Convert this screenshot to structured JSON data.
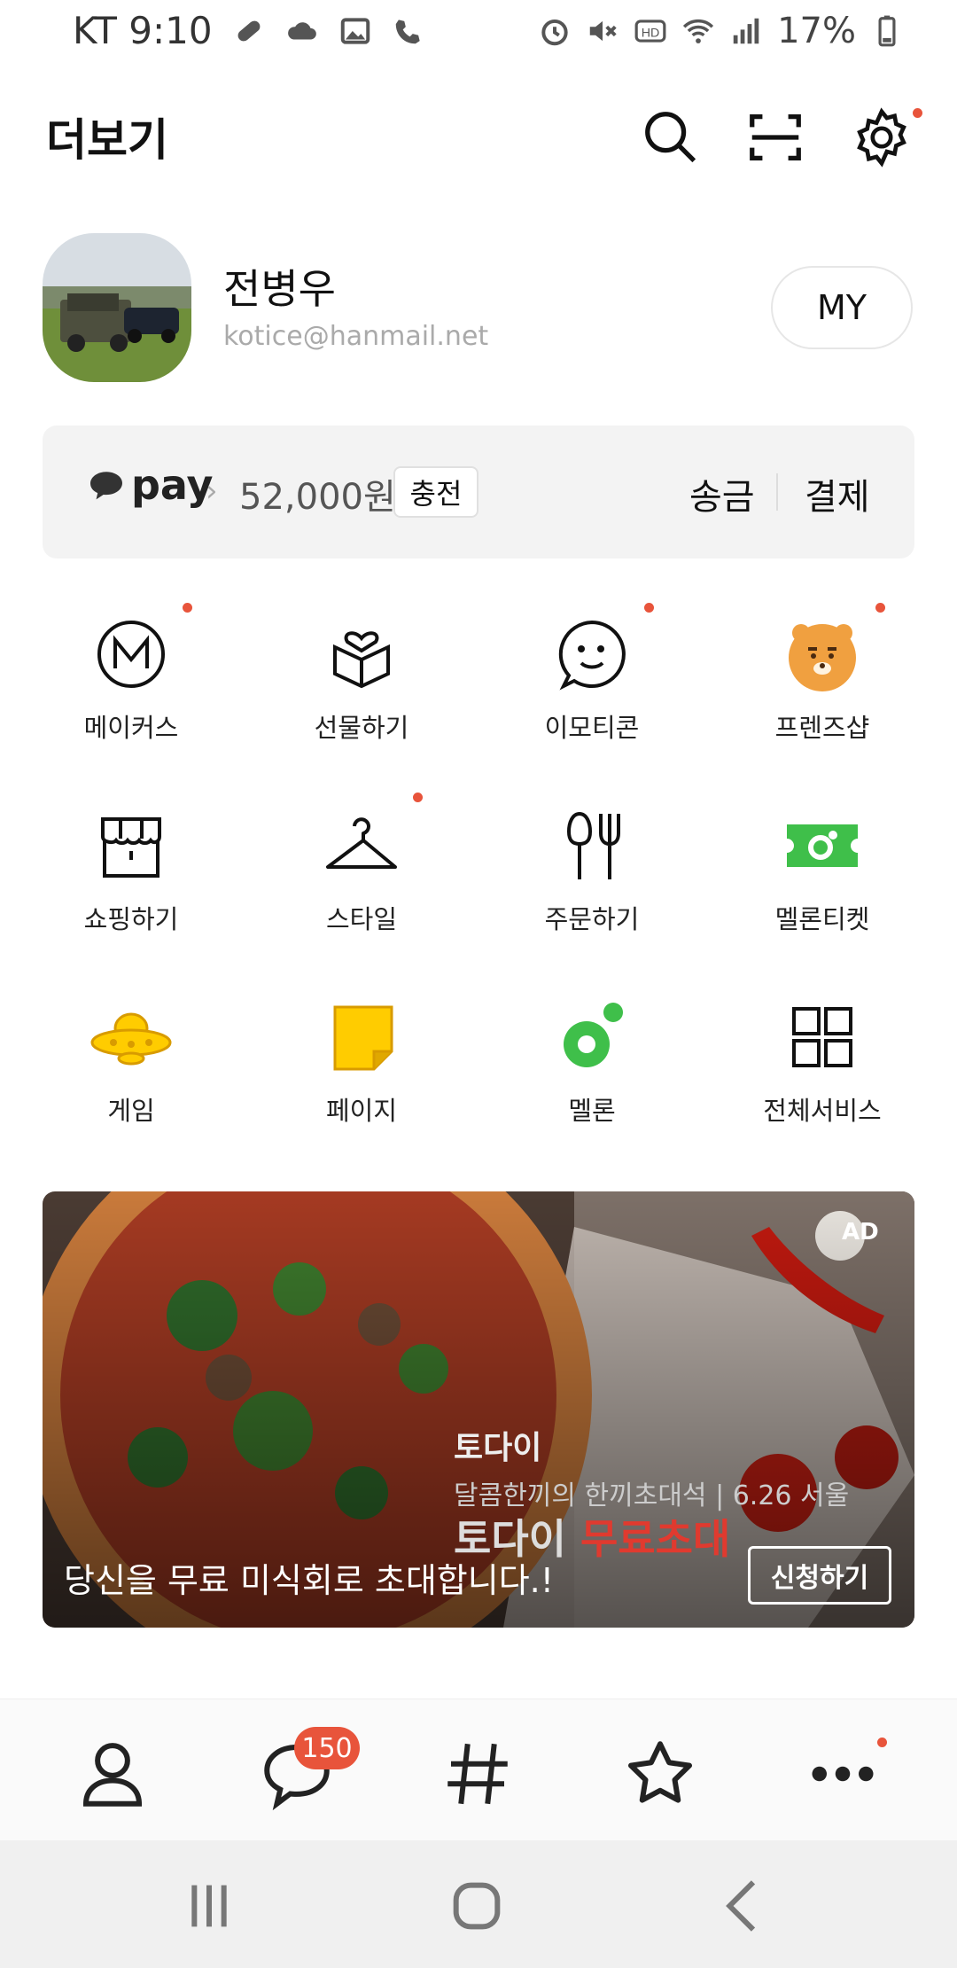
{
  "status_bar": {
    "carrier_time": "KT 9:10",
    "battery": "17%",
    "left_icons": [
      "pill-icon",
      "cloud-icon",
      "image-icon",
      "whowho-call-icon"
    ],
    "right_icons": [
      "alarm-icon",
      "mute-icon",
      "hd-icon",
      "wifi-icon",
      "signal-icon",
      "battery-icon"
    ]
  },
  "header": {
    "title": "더보기",
    "icons": [
      "search-icon",
      "scan-icon",
      "settings-icon"
    ],
    "settings_has_dot": true
  },
  "profile": {
    "name": "전병우",
    "email": "kotice@hanmail.net",
    "my_label": "MY"
  },
  "pay": {
    "logo": "pay",
    "chevron": "›",
    "amount": "52,000원",
    "charge": "충전",
    "send": "송금",
    "payment": "결제"
  },
  "services": [
    {
      "label": "메이커스",
      "icon": "makers-icon",
      "dot": true
    },
    {
      "label": "선물하기",
      "icon": "gift-icon",
      "dot": false
    },
    {
      "label": "이모티콘",
      "icon": "emoticon-icon",
      "dot": true
    },
    {
      "label": "프렌즈샵",
      "icon": "friends-shop-icon",
      "dot": true
    },
    {
      "label": "쇼핑하기",
      "icon": "shop-icon",
      "dot": false
    },
    {
      "label": "스타일",
      "icon": "hanger-icon",
      "dot": true
    },
    {
      "label": "주문하기",
      "icon": "fork-knife-icon",
      "dot": false
    },
    {
      "label": "멜론티켓",
      "icon": "melon-ticket-icon",
      "dot": false
    },
    {
      "label": "게임",
      "icon": "game-ufo-icon",
      "dot": false
    },
    {
      "label": "페이지",
      "icon": "page-icon",
      "dot": false
    },
    {
      "label": "멜론",
      "icon": "melon-icon",
      "dot": false
    },
    {
      "label": "전체서비스",
      "icon": "all-services-icon",
      "dot": false
    }
  ],
  "ad": {
    "tag": "AD",
    "brand": "토다이",
    "subtitle": "달콤한끼의 한끼초대석 | 6.26 서울",
    "headline_white": "토다이 ",
    "headline_red": "무료초대",
    "caption": "당신을 무료 미식회로 초대합니다.!",
    "button": "신청하기"
  },
  "tabs": {
    "items": [
      "friends-tab-icon",
      "chat-tab-icon",
      "hashtag-tab-icon",
      "star-tab-icon",
      "more-tab-icon"
    ],
    "chat_badge": "150"
  },
  "nav": [
    "recent-apps-icon",
    "home-icon",
    "back-icon"
  ],
  "colors": {
    "accent_dot": "#e8543b",
    "pay_bg": "#f3f3f3",
    "melon_green": "#3fbf4a",
    "friends_orange": "#f0a040"
  }
}
